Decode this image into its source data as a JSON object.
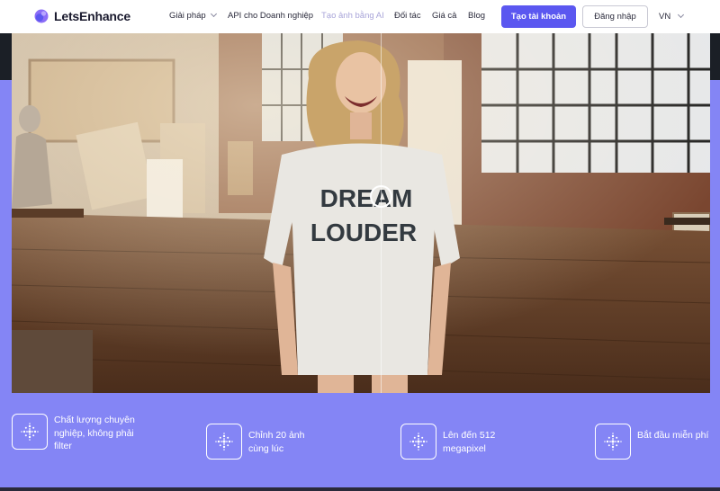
{
  "brand": {
    "name": "LetsEnhance",
    "accent": "#5b57f0",
    "logo_icon": "swirl-logo-icon"
  },
  "nav": {
    "items": [
      {
        "label": "Giải pháp",
        "dropdown": true
      },
      {
        "label": "API cho Doanh nghiệp",
        "dropdown": false
      },
      {
        "label": "Tạo ảnh bằng AI",
        "dropdown": false
      },
      {
        "label": "Đối tác",
        "dropdown": false
      },
      {
        "label": "Giá cả",
        "dropdown": false
      },
      {
        "label": "Blog",
        "dropdown": false
      }
    ],
    "signup_label": "Tạo tài khoản",
    "login_label": "Đăng nhập",
    "language": "VN"
  },
  "hero": {
    "image": "before-after comparison photo",
    "shirt_text_line1": "DREAM",
    "shirt_text_line2": "LOUDER",
    "background": "#8485f5"
  },
  "features": [
    {
      "icon": "sparkle-dots-icon",
      "label": "Chất lượng chuyên nghiệp, không phải filter"
    },
    {
      "icon": "sparkle-dots-icon",
      "label": "Chỉnh 20 ảnh cùng lúc"
    },
    {
      "icon": "sparkle-dots-icon",
      "label": "Lên đến 512 megapixel"
    },
    {
      "icon": "sparkle-dots-icon",
      "label": "Bắt đầu miễn phí"
    }
  ]
}
